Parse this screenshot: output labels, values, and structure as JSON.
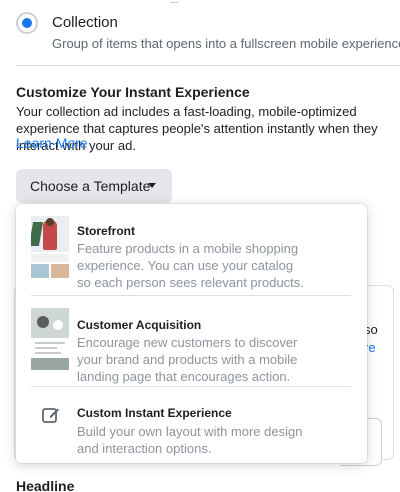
{
  "collection_option": {
    "title": "Collection",
    "description": "Group of items that opens into a fullscreen mobile experience"
  },
  "instant_experience": {
    "heading": "Customize Your Instant Experience",
    "description": "Your collection ad includes a fast-loading, mobile-optimized experience that captures people's attention instantly when they interact with your ad.",
    "learn_more": "Learn More",
    "choose_template_label": "Choose a Template"
  },
  "template_menu": {
    "items": [
      {
        "title": "Storefront",
        "description": "Feature products in a mobile shopping experience. You can use your catalog so each person sees relevant products."
      },
      {
        "title": "Customer Acquisition",
        "description": "Encourage new customers to discover your brand and products with a mobile landing page that encourages action."
      },
      {
        "title": "Custom Instant Experience",
        "description": "Build your own layout with more design and interaction options."
      }
    ]
  },
  "background": {
    "partial_text_1": "so",
    "partial_text_2": "re",
    "headline_label": "Headline"
  },
  "colors": {
    "accent": "#1877f2",
    "button_bg": "#e4e6eb",
    "muted_text": "#8d949e"
  }
}
